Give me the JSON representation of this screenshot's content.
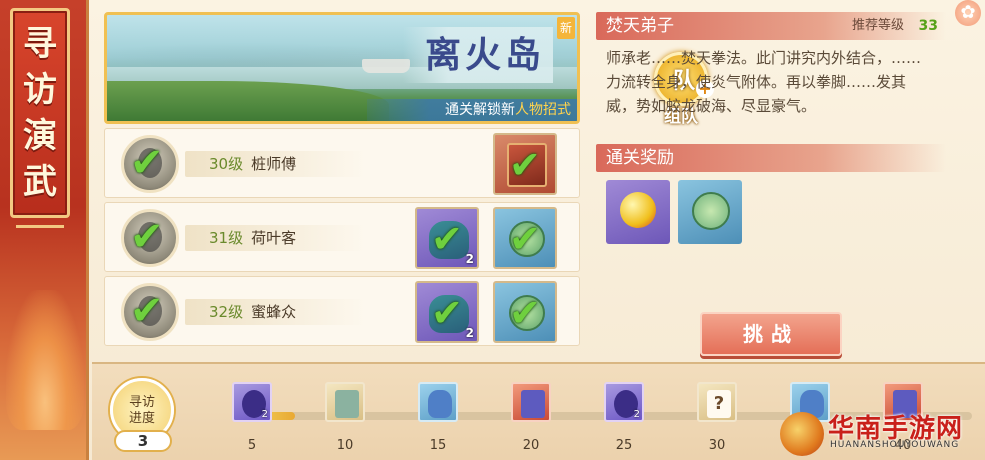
{
  "sidebar": {
    "title_chars": [
      "寻",
      "访",
      "演",
      "武"
    ]
  },
  "featured_stage": {
    "name": "离火岛",
    "new_tag": "新",
    "unlock_text": "通关解锁新",
    "unlock_highlight": "人物招式"
  },
  "team_button": {
    "char": "队",
    "label": "组队"
  },
  "opponents": [
    {
      "level": "30级",
      "name": "桩师傅",
      "rewards": [
        {
          "icon": "book-icon",
          "color": "red",
          "qty": "",
          "claimed": true
        }
      ]
    },
    {
      "level": "31级",
      "name": "荷叶客",
      "rewards": [
        {
          "icon": "coin-bag-icon",
          "color": "purple",
          "qty": "2",
          "claimed": true
        },
        {
          "icon": "jade-coin-icon",
          "color": "blue",
          "qty": "",
          "claimed": true
        }
      ]
    },
    {
      "level": "32级",
      "name": "蜜蜂众",
      "rewards": [
        {
          "icon": "coin-bag-icon",
          "color": "purple",
          "qty": "2",
          "claimed": true
        },
        {
          "icon": "jade-coin-icon",
          "color": "blue",
          "qty": "",
          "claimed": true
        }
      ]
    }
  ],
  "info": {
    "title": "焚天弟子",
    "recommend_label": "推荐等级",
    "recommend_level": "33",
    "description": "师承老……焚天拳法。此门讲究内外结合，……力流转全身，使炎气附体。再以拳脚……发其威，势如蛟龙破海、尽显豪气。",
    "rewards_header": "通关奖励",
    "challenge_label": "挑战"
  },
  "progress": {
    "label_line1": "寻访",
    "label_line2": "进度",
    "count": "3",
    "fraction": 0.06,
    "milestones": [
      {
        "value": "5",
        "icon": "purple-card-icon",
        "style": "purple",
        "qty": "2"
      },
      {
        "value": "10",
        "icon": "map-scroll-icon",
        "style": "gold",
        "qty": ""
      },
      {
        "value": "15",
        "icon": "blue-vase-icon",
        "style": "blue",
        "qty": ""
      },
      {
        "value": "20",
        "icon": "treasure-box-icon",
        "style": "red",
        "qty": ""
      },
      {
        "value": "25",
        "icon": "purple-card-icon",
        "style": "purple",
        "qty": "2"
      },
      {
        "value": "30",
        "icon": "mystery-scroll-icon",
        "style": "scroll",
        "qty": "",
        "glyph": "?"
      },
      {
        "value": "35",
        "icon": "blue-vase-icon",
        "style": "blue",
        "qty": ""
      },
      {
        "value": "40",
        "icon": "treasure-box-icon",
        "style": "red",
        "qty": ""
      }
    ]
  },
  "watermark": {
    "cn": "华南手游网",
    "en": "HUANANSHOUYOUWANG"
  },
  "colors": {
    "accent_red": "#c6402a",
    "gold": "#f0c052",
    "green_check": "#6fd03e"
  }
}
